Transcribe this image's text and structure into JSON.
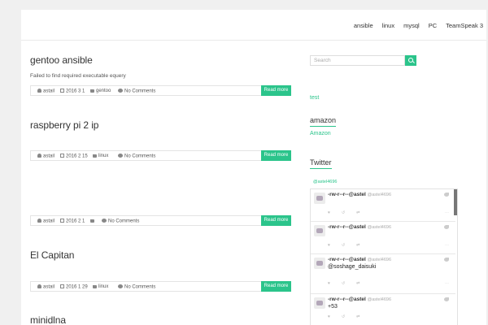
{
  "nav": [
    "ansible",
    "linux",
    "mysql",
    "PC",
    "TeamSpeak 3"
  ],
  "posts": [
    {
      "title": "gentoo ansible",
      "excerpt": "Failed to find required executable equery",
      "author": "astail",
      "date": "2016  3  1",
      "category": "gentoo",
      "comments": "No Comments"
    },
    {
      "title": "raspberry pi 2      ip",
      "author": "astail",
      "date": "2016  2  15",
      "category": "linux",
      "comments": "No Comments"
    },
    {
      "author": "astail",
      "date": "2016  2  1",
      "category": "",
      "comments": "No Comments"
    },
    {
      "title": "El Capitan",
      "author": "astail",
      "date": "2016  1  29",
      "category": "linux",
      "comments": "No Comments"
    },
    {
      "title": "minidlna"
    }
  ],
  "read_more": "Read more",
  "sidebar": {
    "search_placeholder": "Search",
    "link_test": "test",
    "amazon_title": "amazon",
    "amazon_link": "Amazon",
    "twitter_title": "Twitter",
    "twitter_handle": "@astel4696"
  },
  "tweets": [
    {
      "name": "-rw-r--r--@astel",
      "handle": "@astel4696",
      "text": ""
    },
    {
      "name": "-rw-r--r--@astel",
      "handle": "@astel4696",
      "text": ""
    },
    {
      "name": "-rw-r--r--@astel",
      "handle": "@astel4696",
      "text": "@soshage_daisuki"
    },
    {
      "name": "-rw-r--r--@astel",
      "handle": "@astel4696",
      "text": "+53"
    }
  ],
  "colors": {
    "accent": "#2bc48b",
    "text": "#333333",
    "background": "#f0f0f0"
  }
}
